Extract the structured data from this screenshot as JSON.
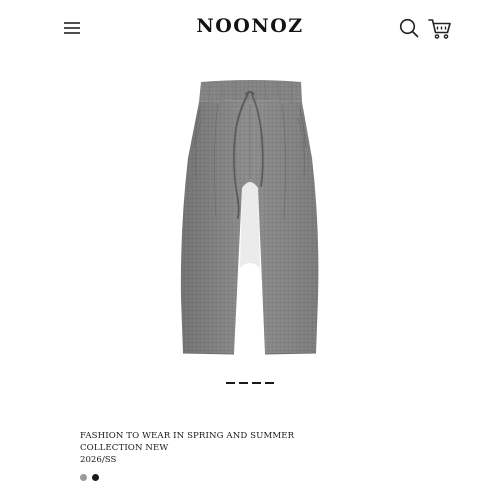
{
  "header": {
    "brand": "NOONOZ",
    "menu_icon": "hamburger-menu-icon",
    "search_icon": "search-icon",
    "cart_icon": "shopping-cart-icon"
  },
  "product": {
    "image_alt": "grey drawstring wide-leg trousers",
    "title": "FASHION TO WEAR IN SPRING AND SUMMER\nCOLLECTION NEW",
    "season": "2026/SS",
    "swatch_colors": [
      "#9a9a9a",
      "#1a1a1a"
    ]
  },
  "carousel": {
    "total": 4,
    "active": 1
  },
  "colors": {
    "background": "#ffffff",
    "text": "#111111",
    "fabric": "#8a8a8a"
  }
}
